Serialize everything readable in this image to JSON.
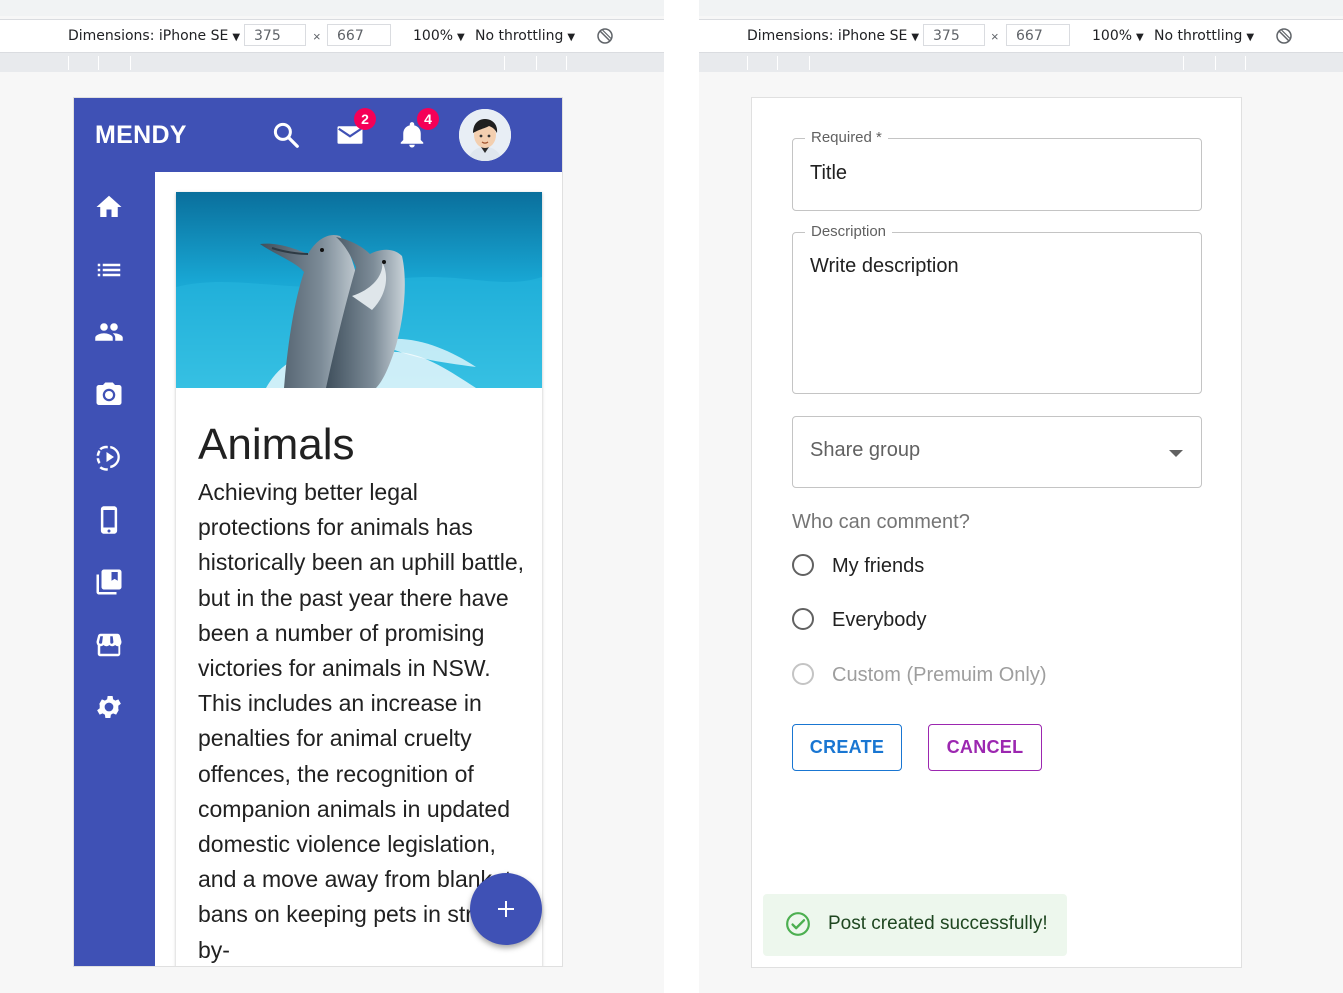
{
  "devtools": {
    "dimensions_label": "Dimensions: iPhone SE",
    "width_value": "375",
    "height_value": "667",
    "x_separator": "×",
    "zoom": "100%",
    "throttling": "No throttling",
    "dropdown_arrow": "▼"
  },
  "left_app": {
    "brand": "MENDY",
    "mail_badge": "2",
    "notification_badge": "4",
    "sidebar_icons": [
      "home-icon",
      "list-icon",
      "people-icon",
      "camera-icon",
      "slow-motion-video-icon",
      "phone-icon",
      "library-books-icon",
      "storefront-icon",
      "settings-icon"
    ],
    "card": {
      "title": "Animals",
      "body": "Achieving better legal protections for animals has historically been an uphill battle, but in the past year there have been a number of promising victories for animals in NSW. This includes an increase in penalties for animal cruelty offences, the recognition of companion animals in updated domestic violence legislation, and a move away from blanket bans on keeping pets in strata by-"
    },
    "fab_label": "+"
  },
  "right_app": {
    "title_field": {
      "label": "Required *",
      "value": "Title"
    },
    "description_field": {
      "label": "Description",
      "value": "Write description"
    },
    "share_group": {
      "placeholder": "Share group"
    },
    "comment_group": {
      "label": "Who can comment?",
      "options": [
        {
          "label": "My friends",
          "disabled": false
        },
        {
          "label": "Everybody",
          "disabled": false
        },
        {
          "label": "Custom (Premuim Only)",
          "disabled": true
        }
      ]
    },
    "create_label": "CREATE",
    "cancel_label": "CANCEL",
    "toast": "Post created successfully!"
  },
  "colors": {
    "primary": "#3f51b5",
    "badge": "#f50057",
    "create": "#1976d2",
    "cancel": "#9c27b0",
    "success_bg": "#edf7ed",
    "success_icon": "#4caf50"
  }
}
